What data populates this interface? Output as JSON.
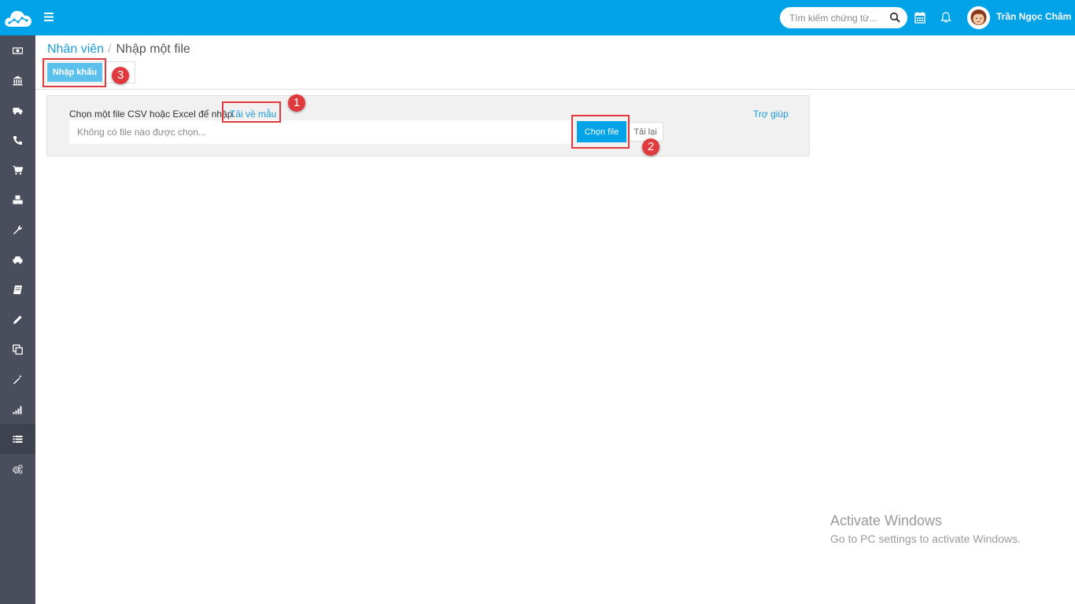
{
  "header": {
    "search_placeholder": "Tìm kiếm chứng từ...",
    "user_name": "Trần Ngọc Châm",
    "accent_color": "#00a2e8"
  },
  "sidebar": {
    "items": [
      {
        "icon": "money-icon"
      },
      {
        "icon": "bank-icon"
      },
      {
        "icon": "truck-icon"
      },
      {
        "icon": "phone-icon"
      },
      {
        "icon": "cart-icon"
      },
      {
        "icon": "cubes-icon"
      },
      {
        "icon": "wrench-icon"
      },
      {
        "icon": "car-icon"
      },
      {
        "icon": "book-icon"
      },
      {
        "icon": "pencil-icon"
      },
      {
        "icon": "copy-icon"
      },
      {
        "icon": "magic-wand-icon"
      },
      {
        "icon": "signal-icon"
      },
      {
        "icon": "list-icon",
        "active": true
      },
      {
        "icon": "cogs-icon"
      }
    ]
  },
  "breadcrumb": {
    "parent": "Nhân viên",
    "separator": "/",
    "current": "Nhập một file"
  },
  "toolbar": {
    "import_label": "Nhập khẩu"
  },
  "import_panel": {
    "instruction": "Chọn một file CSV hoặc Excel để nhập.",
    "download_template": "Tải về mẫu",
    "help": "Trợ giúp",
    "file_placeholder": "Không có file nào được chọn...",
    "choose_file": "Chọn file",
    "reload": "Tải lại"
  },
  "annotations": {
    "badge_1": "1",
    "badge_2": "2",
    "badge_3": "3",
    "highlight_color": "#e0393e"
  },
  "watermark": {
    "title": "Activate Windows",
    "subtitle": "Go to PC settings to activate Windows."
  }
}
